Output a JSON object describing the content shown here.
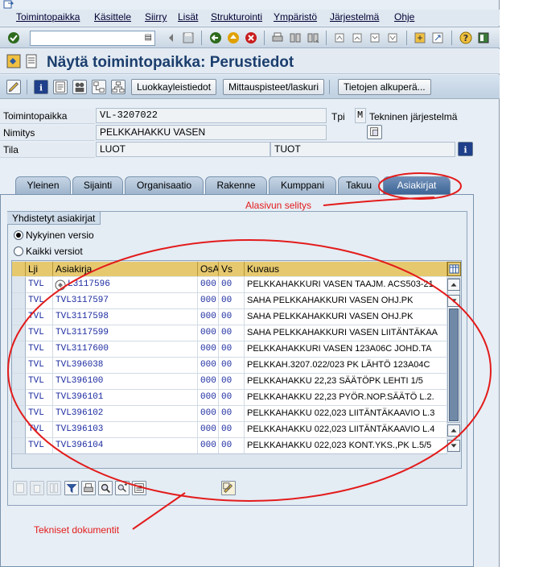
{
  "menubar": {
    "items": [
      "Toimintopaikka",
      "Käsittele",
      "Siirry",
      "Lisät",
      "Strukturointi",
      "Ympäristö",
      "Järjestelmä",
      "Ohje"
    ]
  },
  "header": {
    "title": "Näytä toimintopaikka: Perustiedot"
  },
  "app_toolbar": {
    "buttons": [
      "Luokkayleistiedot",
      "Mittauspisteet/laskuri",
      "Tietojen alkuperä..."
    ]
  },
  "fields": {
    "toimintopaikka_label": "Toimintopaikka",
    "toimintopaikka_value": "VL-3207022",
    "tpi_label": "Tpi",
    "tpi_value": "M",
    "tpi_text": "Tekninen järjestelmä",
    "nimitys_label": "Nimitys",
    "nimitys_value": "PELKKAHAKKU VASEN",
    "tila_label": "Tila",
    "tila_value1": "LUOT",
    "tila_value2": "TUOT"
  },
  "tabs": [
    "Yleinen",
    "Sijainti",
    "Organisaatio",
    "Rakenne",
    "Kumppani",
    "Takuu",
    "Asiakirjat"
  ],
  "active_tab": "Asiakirjat",
  "groupbox": {
    "title": "Yhdistetyt asiakirjat",
    "radio_current": "Nykyinen versio",
    "radio_all": "Kaikki versiot"
  },
  "table": {
    "columns": [
      "Lji",
      "Asiakirja",
      "OsA",
      "Vs",
      "Kuvaus"
    ],
    "rows": [
      {
        "lji": "TVL",
        "doc": "L3117596",
        "osa": "000",
        "vs": "00",
        "desc": "PELKKAHAKKURI VASEN TAAJM. ACS503-21"
      },
      {
        "lji": "TVL",
        "doc": "TVL3117597",
        "osa": "000",
        "vs": "00",
        "desc": "SAHA PELKKAHAKKURI VASEN OHJ.PK"
      },
      {
        "lji": "TVL",
        "doc": "TVL3117598",
        "osa": "000",
        "vs": "00",
        "desc": "SAHA PELKKAHAKKURI VASEN OHJ.PK"
      },
      {
        "lji": "TVL",
        "doc": "TVL3117599",
        "osa": "000",
        "vs": "00",
        "desc": "SAHA PELKKAHAKKURI VASEN LIITÄNTÄKAA"
      },
      {
        "lji": "TVL",
        "doc": "TVL3117600",
        "osa": "000",
        "vs": "00",
        "desc": "PELKKAHAKKURI VASEN 123A06C JOHD.TA"
      },
      {
        "lji": "TVL",
        "doc": "TVL396038",
        "osa": "000",
        "vs": "00",
        "desc": "PELKKAH.3207.022/023 PK LÄHTÖ 123A04C"
      },
      {
        "lji": "TVL",
        "doc": "TVL396100",
        "osa": "000",
        "vs": "00",
        "desc": "PELKKAHAKKU 22,23 SÄÄTÖPK LEHTI 1/5"
      },
      {
        "lji": "TVL",
        "doc": "TVL396101",
        "osa": "000",
        "vs": "00",
        "desc": "PELKKAHAKKU 22,23 PYÖR.NOP.SÄÄTÖ L.2."
      },
      {
        "lji": "TVL",
        "doc": "TVL396102",
        "osa": "000",
        "vs": "00",
        "desc": "PELKKAHAKKU 022,023 LIITÄNTÄKAAVIO L.3"
      },
      {
        "lji": "TVL",
        "doc": "TVL396103",
        "osa": "000",
        "vs": "00",
        "desc": "PELKKAHAKKU 022,023 LIITÄNTÄKAAVIO L.4"
      },
      {
        "lji": "TVL",
        "doc": "TVL396104",
        "osa": "000",
        "vs": "00",
        "desc": "PELKKAHAKKU 022,023 KONT.YKS.,PK L.5/5"
      }
    ]
  },
  "annotations": {
    "tab_note": "Alasivun selitys",
    "doc_note": "Tekniset dokumentit"
  },
  "colors": {
    "annotation": "#e31b1b",
    "column_header": "#e6c96f",
    "active_tab": "#3d6596",
    "title": "#1b3e6d"
  }
}
